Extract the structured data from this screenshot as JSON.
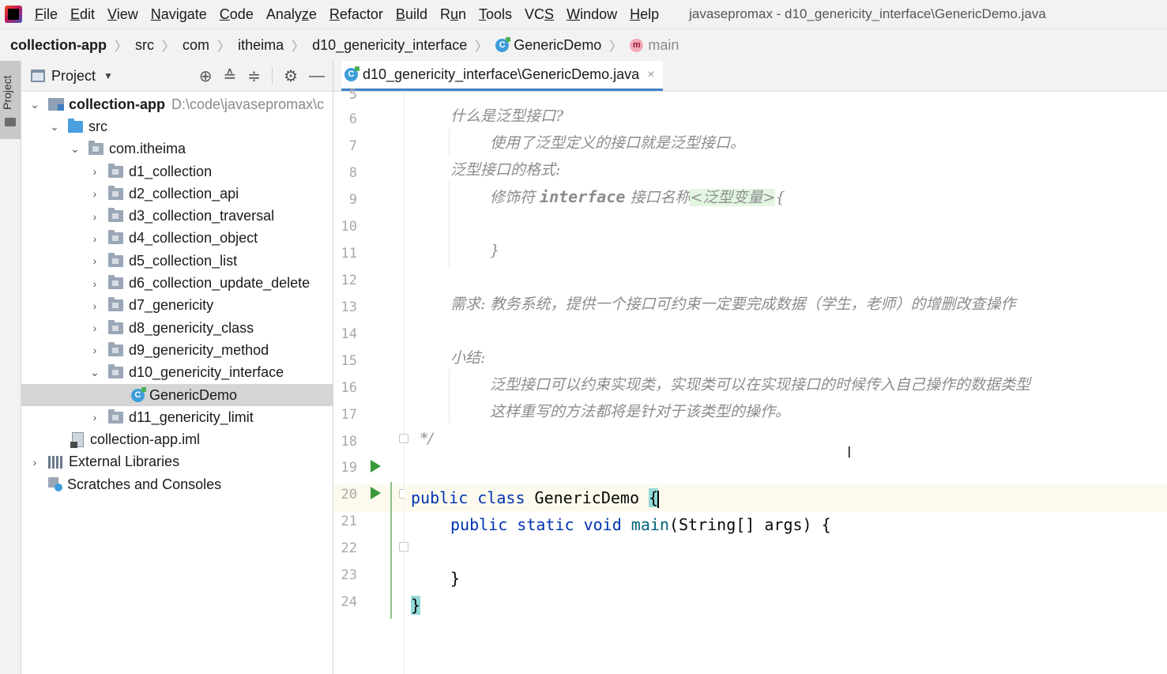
{
  "menubar": {
    "items": [
      "File",
      "Edit",
      "View",
      "Navigate",
      "Code",
      "Analyze",
      "Refactor",
      "Build",
      "Run",
      "Tools",
      "VCS",
      "Window",
      "Help"
    ],
    "underline": [
      "F",
      "E",
      "V",
      "N",
      "C",
      "z",
      "R",
      "B",
      "u",
      "T",
      "S",
      "W",
      "H"
    ],
    "window_title": "javasepromax - d10_genericity_interface\\GenericDemo.java"
  },
  "breadcrumb": {
    "items": [
      "collection-app",
      "src",
      "com",
      "itheima",
      "d10_genericity_interface",
      "GenericDemo",
      "main"
    ]
  },
  "tool_strip": {
    "project_label": "Project"
  },
  "project_panel": {
    "title": "Project",
    "tree": [
      {
        "label": "collection-app",
        "path": "D:\\code\\javasepromax\\c"
      },
      {
        "label": "src"
      },
      {
        "label": "com.itheima"
      },
      {
        "label": "d1_collection"
      },
      {
        "label": "d2_collection_api"
      },
      {
        "label": "d3_collection_traversal"
      },
      {
        "label": "d4_collection_object"
      },
      {
        "label": "d5_collection_list"
      },
      {
        "label": "d6_collection_update_delete"
      },
      {
        "label": "d7_genericity"
      },
      {
        "label": "d8_genericity_class"
      },
      {
        "label": "d9_genericity_method"
      },
      {
        "label": "d10_genericity_interface"
      },
      {
        "label": "GenericDemo"
      },
      {
        "label": "d11_genericity_limit"
      },
      {
        "label": "collection-app.iml"
      },
      {
        "label": "External Libraries"
      },
      {
        "label": "Scratches and Consoles"
      }
    ]
  },
  "editor": {
    "tab_label": "d10_genericity_interface\\GenericDemo.java",
    "line_numbers": [
      "5",
      "6",
      "7",
      "8",
      "9",
      "10",
      "11",
      "12",
      "13",
      "14",
      "15",
      "16",
      "17",
      "18",
      "19",
      "20",
      "21",
      "22",
      "23",
      "24"
    ],
    "comments": {
      "l6": "什么是泛型接口?",
      "l7": "使用了泛型定义的接口就是泛型接口。",
      "l8": "泛型接口的格式:",
      "l9_a": "修饰符 ",
      "l9_kw": "interface",
      "l9_b": " 接口名称",
      "l9_gen": "<泛型变量>",
      "l9_c": "{",
      "l11": "}",
      "l13": "需求: 教务系统，提供一个接口可约束一定要完成数据（学生，老师）的增删改查操作",
      "l15": "小结:",
      "l16": "泛型接口可以约束实现类，实现类可以在实现接口的时候传入自己操作的数据类型",
      "l17": "这样重写的方法都将是针对于该类型的操作。",
      "l18": "*/"
    },
    "code": {
      "l19_kw": "public class",
      "l19_name": "GenericDemo",
      "l19_brace": "{",
      "l20_kw": "public static void",
      "l20_fn": "main",
      "l20_rest": "(String[] args) {",
      "l22": "}",
      "l23": "}"
    }
  }
}
